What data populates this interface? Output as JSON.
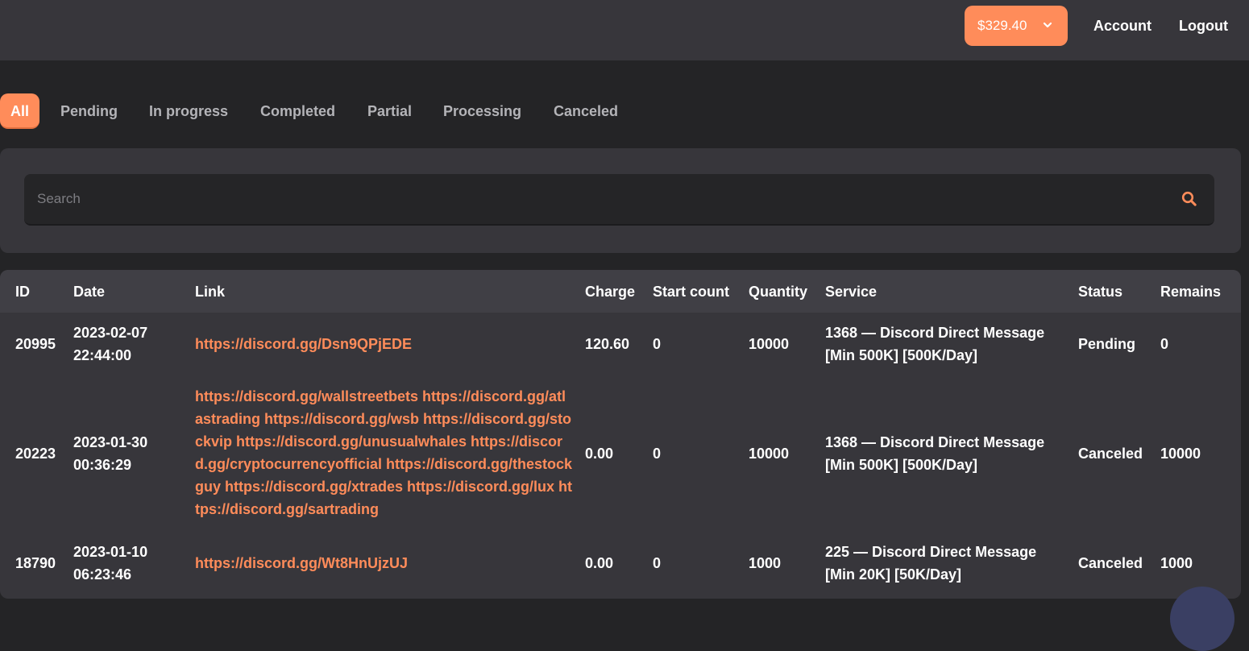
{
  "header": {
    "balance": "$329.40",
    "account_label": "Account",
    "logout_label": "Logout"
  },
  "tabs": [
    "All",
    "Pending",
    "In progress",
    "Completed",
    "Partial",
    "Processing",
    "Canceled"
  ],
  "active_tab": "All",
  "search": {
    "placeholder": "Search",
    "value": ""
  },
  "table": {
    "columns": [
      "ID",
      "Date",
      "Link",
      "Charge",
      "Start count",
      "Quantity",
      "Service",
      "Status",
      "Remains"
    ],
    "rows": [
      {
        "id": "20995",
        "date": "2023-02-07",
        "time": "22:44:00",
        "link": "https://discord.gg/Dsn9QPjEDE",
        "charge": "120.60",
        "start_count": "0",
        "quantity": "10000",
        "service_line1": "1368 — Discord Direct Message",
        "service_line2": "[Min 500K] [500K/Day]",
        "status": "Pending",
        "remains": "0"
      },
      {
        "id": "20223",
        "date": "2023-01-30",
        "time": "00:36:29",
        "link": "https://discord.gg/wallstreetbets https://discord.gg/atlastrading https://discord.gg/wsb https://discord.gg/stockvip https://discord.gg/unusualwhales https://discord.gg/cryptocurrencyofficial https://discord.gg/thestockguy https://discord.gg/xtrades https://discord.gg/lux https://discord.gg/sartrading",
        "charge": "0.00",
        "start_count": "0",
        "quantity": "10000",
        "service_line1": "1368 — Discord Direct Message",
        "service_line2": "[Min 500K] [500K/Day]",
        "status": "Canceled",
        "remains": "10000"
      },
      {
        "id": "18790",
        "date": "2023-01-10",
        "time": "06:23:46",
        "link": "https://discord.gg/Wt8HnUjzUJ",
        "charge": "0.00",
        "start_count": "0",
        "quantity": "1000",
        "service_line1": "225 — Discord Direct Message",
        "service_line2": "[Min 20K] [50K/Day]",
        "status": "Canceled",
        "remains": "1000"
      }
    ]
  },
  "colors": {
    "accent": "#ff8c5a",
    "topbar": "#37363b",
    "background": "#242426",
    "panel": "#37363b",
    "table_header": "#403f45"
  }
}
